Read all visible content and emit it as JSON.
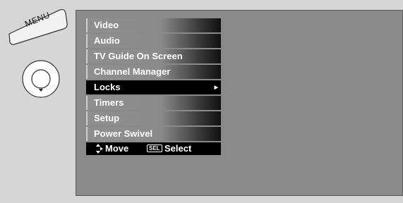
{
  "remote": {
    "menu_button_label": "MENU"
  },
  "menu": {
    "items": [
      {
        "label": "Video"
      },
      {
        "label": "Audio"
      },
      {
        "label": "TV Guide On Screen"
      },
      {
        "label": "Channel Manager"
      },
      {
        "label": "Locks",
        "has_submenu_arrow": true
      },
      {
        "label": "Timers"
      },
      {
        "label": "Setup"
      },
      {
        "label": "Power Swivel"
      }
    ],
    "selected_index": 4
  },
  "hint_bar": {
    "move_label": "Move",
    "sel_key": "SEL",
    "select_label": "Select"
  },
  "colors": {
    "page_background": "#d6d6d6",
    "screen_background": "#8a8a8a",
    "selected_item": "#000000",
    "text": "#ffffff"
  },
  "icons": {
    "move": "up-down-right-arrows-icon",
    "joystick": "joystick-icon",
    "submenu": "triangle-right-icon"
  }
}
